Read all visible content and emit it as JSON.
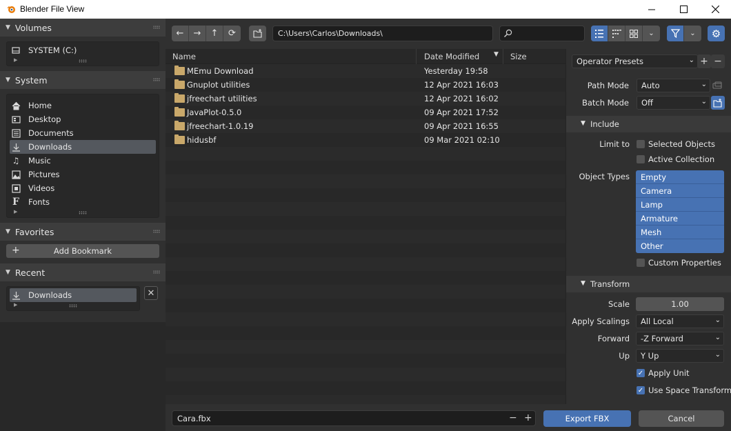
{
  "window": {
    "title": "Blender File View"
  },
  "sidebar": {
    "volumes": {
      "title": "Volumes",
      "items": [
        {
          "label": "SYSTEM (C:)",
          "icon": "drive-icon"
        }
      ]
    },
    "system": {
      "title": "System",
      "items": [
        {
          "label": "Home",
          "icon": "home-icon"
        },
        {
          "label": "Desktop",
          "icon": "desktop-icon"
        },
        {
          "label": "Documents",
          "icon": "documents-icon"
        },
        {
          "label": "Downloads",
          "icon": "download-icon",
          "active": true
        },
        {
          "label": "Music",
          "icon": "music-icon"
        },
        {
          "label": "Pictures",
          "icon": "pictures-icon"
        },
        {
          "label": "Videos",
          "icon": "videos-icon"
        },
        {
          "label": "Fonts",
          "icon": "fonts-icon"
        }
      ]
    },
    "favorites": {
      "title": "Favorites",
      "add_bookmark": "Add Bookmark"
    },
    "recent": {
      "title": "Recent",
      "items": [
        {
          "label": "Downloads",
          "icon": "download-icon"
        }
      ]
    }
  },
  "toolbar": {
    "path": "C:\\Users\\Carlos\\Downloads\\",
    "search_placeholder": ""
  },
  "filelist": {
    "columns": {
      "name": "Name",
      "date": "Date Modified",
      "size": "Size"
    },
    "rows": [
      {
        "name": "MEmu Download",
        "date": "Yesterday 19:58"
      },
      {
        "name": "Gnuplot utilities",
        "date": "12 Apr 2021 16:03"
      },
      {
        "name": "jfreechart utilities",
        "date": "12 Apr 2021 16:02"
      },
      {
        "name": "JavaPlot-0.5.0",
        "date": "09 Apr 2021 17:52"
      },
      {
        "name": "jfreechart-1.0.19",
        "date": "09 Apr 2021 16:55"
      },
      {
        "name": "hidusbf",
        "date": "09 Mar 2021 02:10"
      }
    ]
  },
  "bottom": {
    "filename": "Cara.fbx",
    "export_label": "Export FBX",
    "cancel_label": "Cancel"
  },
  "operator": {
    "presets": "Operator Presets",
    "path_mode": {
      "label": "Path Mode",
      "value": "Auto"
    },
    "batch_mode": {
      "label": "Batch Mode",
      "value": "Off"
    },
    "include": {
      "title": "Include",
      "limit_to_label": "Limit to",
      "selected_objects": "Selected Objects",
      "active_collection": "Active Collection",
      "object_types_label": "Object Types",
      "object_types": [
        "Empty",
        "Camera",
        "Lamp",
        "Armature",
        "Mesh",
        "Other"
      ],
      "custom_properties": "Custom Properties"
    },
    "transform": {
      "title": "Transform",
      "scale": {
        "label": "Scale",
        "value": "1.00"
      },
      "apply_scalings": {
        "label": "Apply Scalings",
        "value": "All Local"
      },
      "forward": {
        "label": "Forward",
        "value": "-Z Forward"
      },
      "up": {
        "label": "Up",
        "value": "Y Up"
      },
      "apply_unit": "Apply Unit",
      "use_space_transform": "Use Space Transform"
    }
  },
  "colors": {
    "accent": "#4772b3",
    "panel": "#303030",
    "list": "#282828"
  }
}
